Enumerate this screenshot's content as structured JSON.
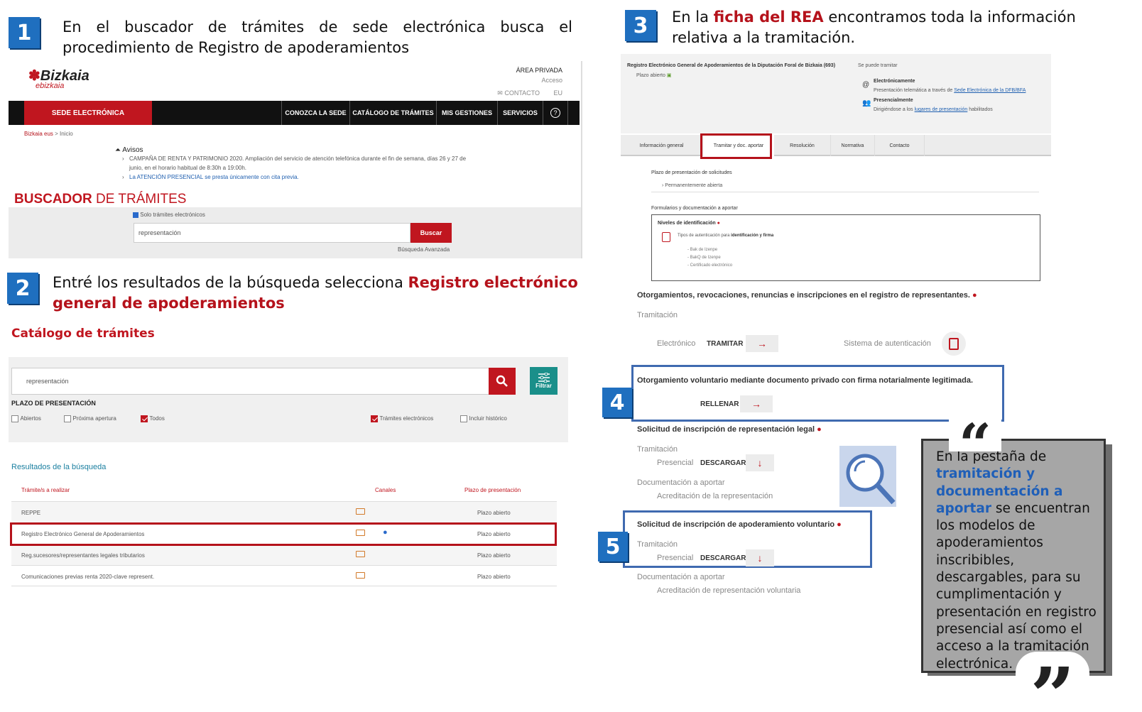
{
  "steps": {
    "s1": {
      "num": "1",
      "text": "En el buscador de trámites de sede electrónica   busca el procedimiento de Registro de apoderamientos"
    },
    "s2": {
      "num": "2",
      "text_a": "Entré los resultados de la búsqueda selecciona ",
      "text_b": "Registro electrónico general de apoderamientos"
    },
    "s3": {
      "num": "3",
      "text_a": "En la ",
      "text_b": "ficha del REA",
      "text_c": " encontramos toda la información relativa a la tramitación."
    },
    "s4": {
      "num": "4"
    },
    "s5": {
      "num": "5"
    }
  },
  "bizkaia": {
    "logo": "Bizkaia",
    "logo_sub": "ebizkaia",
    "area_privada": "ÁREA PRIVADA",
    "acceso": "Acceso",
    "contacto": "CONTACTO",
    "eu": "EU",
    "sede": "SEDE ELECTRÓNICA",
    "nav": [
      "CONOZCA LA SEDE",
      "CATÁLOGO DE TRÁMITES",
      "MIS GESTIONES",
      "SERVICIOS"
    ],
    "help": "?",
    "breadcrumb_a": "Bizkaia eus",
    "breadcrumb_b": " > Inicio",
    "avisos": "Avisos",
    "aviso1": "CAMPAÑA DE RENTA Y PATRIMONIO 2020. Ampliación del servicio de atención telefónica durante el fin de semana, días 26 y 27 de junio, en el horario habitual de 8:30h a 19:00h.",
    "aviso2": "La ATENCIÓN PRESENCIAL se presta únicamente con cita previa.",
    "buscador_a": "BUSCADOR",
    "buscador_b": " DE TRÁMITES",
    "solo": "Solo trámites electrónicos",
    "search_value": "representación",
    "buscar": "Buscar",
    "avanzada": "Búsqueda Avanzada"
  },
  "catalogo": {
    "title": "Catálogo de trámites",
    "search_value": "representación",
    "filtrar": "Filtrar",
    "plazo": "PLAZO DE PRESENTACIÓN",
    "checks": [
      "Abiertos",
      "Próxima apertura",
      "Todos",
      "Trámites electrónicos",
      "Incluir histórico"
    ],
    "results_title": "Resultados de la búsqueda",
    "col1": "Trámite/s a realizar",
    "col2": "Canales",
    "col3": "Plazo de presentación",
    "rows": [
      {
        "name": "REPPE",
        "plazo": "Plazo abierto"
      },
      {
        "name": "Registro Electrónico General de Apoderamientos",
        "plazo": "Plazo abierto"
      },
      {
        "name": "Reg.sucesores/representantes legales tributarios",
        "plazo": "Plazo abierto"
      },
      {
        "name": "Comunicaciones previas renta 2020-clave represent.",
        "plazo": "Plazo abierto"
      }
    ]
  },
  "ficha": {
    "title": "Registro Electrónico General de Apoderamientos de la Diputación Foral de Bizkaia (693)",
    "plazo": "Plazo abierto",
    "se_puede": "Se puede tramitar",
    "elec": "Electrónicamente",
    "elec_desc_a": "Presentación telemática a través de ",
    "elec_desc_b": "Sede Electrónica de la DFB/BFA",
    "pres": "Presencialmente",
    "pres_desc_a": "Dirigiéndose a los ",
    "pres_desc_b": "lugares de presentación",
    "pres_desc_c": " habilitados",
    "tabs": [
      "Información general",
      "Tramitar y doc. aportar",
      "Resolución",
      "Normativa",
      "Contacto"
    ],
    "plazo_sol": "Plazo de presentación de solicitudes",
    "perm": "Permanentemente abierta",
    "formularios": "Formularios y documentación a aportar",
    "niveles": "Niveles de identificación",
    "tipos_a": "Tipos de autenticación para ",
    "tipos_b": "identificación y firma",
    "auth": [
      "- Bak de Izenpe",
      "- BakQ de Izenpe",
      "- Certificado electrónico"
    ],
    "otorg": "Otorgamientos, revocaciones, renuncias e inscripciones en el registro de representantes.",
    "tramitacion": "Tramitación",
    "electronico": "Electrónico",
    "tramitar": "TRAMITAR",
    "sistema": "Sistema de autenticación",
    "vol": "Otorgamiento voluntario mediante documento privado con firma notarialmente legitimada.",
    "rellenar": "RELLENAR",
    "sol_legal": "Solicitud de inscripción de representación legal",
    "presencial": "Presencial",
    "descargar": "DESCARGAR",
    "doc_aportar": "Documentación a aportar",
    "acred": "Acreditación de la representación",
    "sol_vol": "Solicitud de inscripción de apoderamiento voluntario",
    "acred_vol": "Acreditación de representación voluntaria"
  },
  "quote": {
    "a": "En la pestaña de ",
    "b": "tramitación y documentación a aportar",
    "c": " se encuentran los modelos de apoderamientos inscribibles, descargables, para su cumplimentación y presentación en registro presencial así como el acceso  a la tramitación electrónica."
  },
  "colors": {
    "accent": "#b5121b",
    "blue": "#1f6fbf",
    "teal": "#1a8f8a"
  }
}
